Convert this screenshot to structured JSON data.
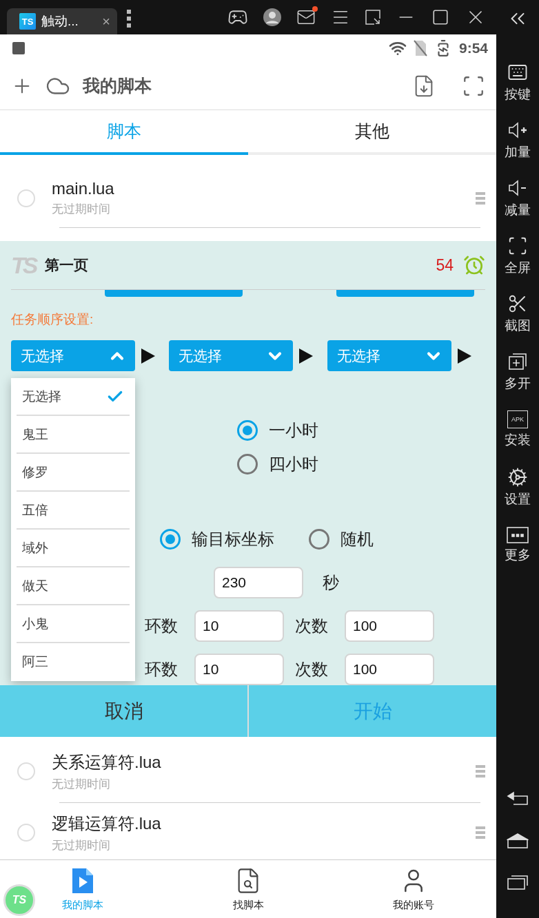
{
  "emulator": {
    "tab": {
      "logo": "TS",
      "title": "触动...",
      "close": "×"
    },
    "sidebar": [
      {
        "kind": "keyboard",
        "label": "按键"
      },
      {
        "kind": "volume-up",
        "label": "加量"
      },
      {
        "kind": "volume-down",
        "label": "减量"
      },
      {
        "kind": "fullscreen",
        "label": "全屏"
      },
      {
        "kind": "scissors",
        "label": "截图"
      },
      {
        "kind": "multi",
        "label": "多开"
      },
      {
        "kind": "apk",
        "label": "安装",
        "badge": "APK"
      },
      {
        "kind": "gear",
        "label": "设置"
      },
      {
        "kind": "more",
        "label": "更多"
      }
    ]
  },
  "status_bar": {
    "time": "9:54"
  },
  "app_bar": {
    "title": "我的脚本"
  },
  "tabs": [
    {
      "label": "脚本",
      "selected": true
    },
    {
      "label": "其他",
      "selected": false
    }
  ],
  "scripts_top": [
    {
      "name": "main.lua",
      "subtitle": "无过期时间",
      "selected": false
    }
  ],
  "dialog": {
    "logo": "TS",
    "title": "第一页",
    "countdown": "54",
    "section_label": "任务顺序设置:",
    "selects": [
      {
        "value": "无选择",
        "expanded": true
      },
      {
        "value": "无选择",
        "expanded": false
      },
      {
        "value": "无选择",
        "expanded": false
      }
    ],
    "menu": [
      {
        "label": "无选择",
        "selected": true
      },
      {
        "label": "鬼王",
        "selected": false
      },
      {
        "label": "修罗",
        "selected": false
      },
      {
        "label": "五倍",
        "selected": false
      },
      {
        "label": "域外",
        "selected": false
      },
      {
        "label": "做天",
        "selected": false
      },
      {
        "label": "小鬼",
        "selected": false
      },
      {
        "label": "阿三",
        "selected": false
      }
    ],
    "duration_options": [
      {
        "label": "一小时",
        "selected": true
      },
      {
        "label": "四小时",
        "selected": false
      }
    ],
    "target_options": [
      {
        "label": "输目标坐标",
        "selected": true
      },
      {
        "label": "随机",
        "selected": false
      }
    ],
    "wait": {
      "value": "230",
      "unit": "秒"
    },
    "task_rows": [
      {
        "rings_label": "环数",
        "rings": "10",
        "times_label": "次数",
        "times": "100"
      },
      {
        "rings_label": "环数",
        "rings": "10",
        "times_label": "次数",
        "times": "100"
      }
    ],
    "buttons": [
      {
        "kind": "cancel",
        "label": "取消"
      },
      {
        "kind": "start",
        "label": "开始"
      }
    ]
  },
  "scripts_bottom": [
    {
      "name": "关系运算符.lua",
      "subtitle": "无过期时间",
      "selected": false
    },
    {
      "name": "逻辑运算符.lua",
      "subtitle": "无过期时间",
      "selected": false
    }
  ],
  "bottom_nav": [
    {
      "kind": "my-scripts",
      "label": "我的脚本",
      "selected": true
    },
    {
      "kind": "find",
      "label": "找脚本",
      "selected": false
    },
    {
      "kind": "account",
      "label": "我的账号",
      "selected": false
    }
  ],
  "fab": {
    "logo": "TS"
  }
}
